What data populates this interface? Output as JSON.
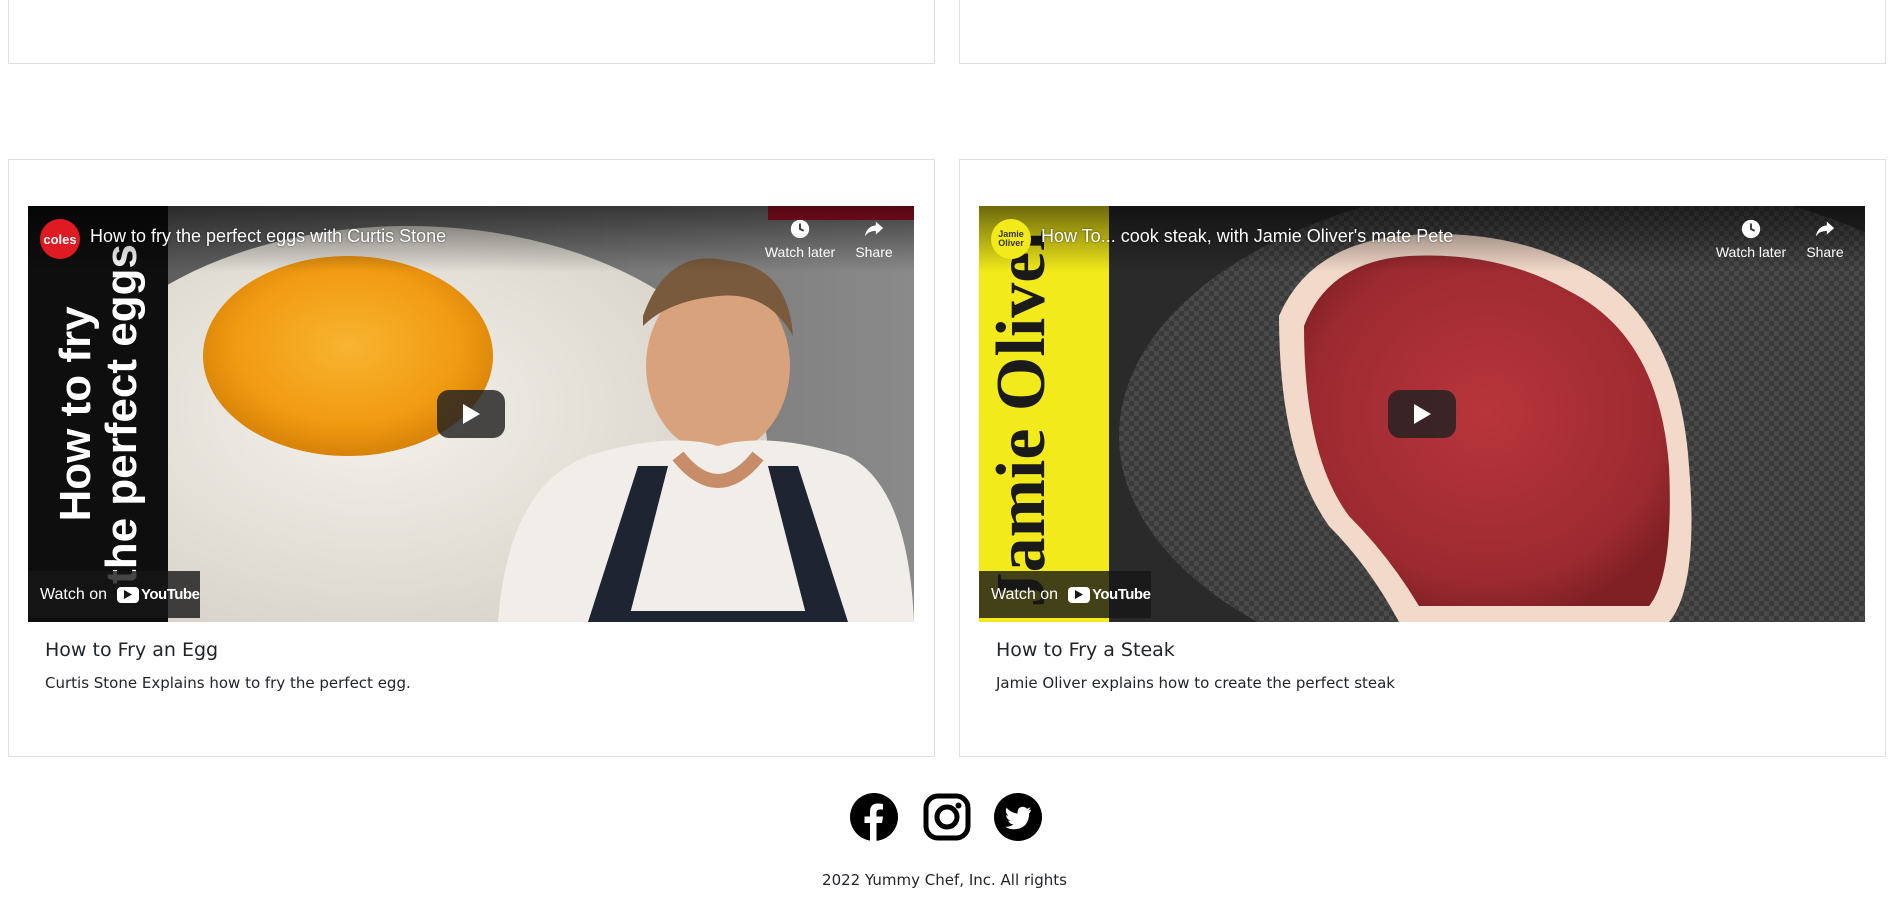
{
  "cards": [
    {
      "title": "How to Fry an Egg",
      "text": "Curtis Stone Explains how to fry the perfect egg.",
      "video": {
        "title": "How to fry the perfect eggs with Curtis Stone",
        "channel_logo": "coles",
        "thumb_text": "How to fry the perfect eggs",
        "watch_later": "Watch later",
        "share": "Share",
        "watch_on": "Watch on",
        "youtube": "YouTube"
      }
    },
    {
      "title": "How to Fry a Steak",
      "text": "Jamie Oliver explains how to create the perfect steak",
      "video": {
        "title": "How To... cook steak, with Jamie Oliver's mate Pete",
        "channel_logo": "Jamie Oliver",
        "thumb_text": "Jamie Oliver",
        "watch_later": "Watch later",
        "share": "Share",
        "watch_on": "Watch on",
        "youtube": "YouTube"
      }
    }
  ],
  "footer": {
    "social": [
      "facebook-icon",
      "instagram-icon",
      "twitter-icon"
    ],
    "copyright": "2022 Yummy Chef, Inc. All rights"
  }
}
